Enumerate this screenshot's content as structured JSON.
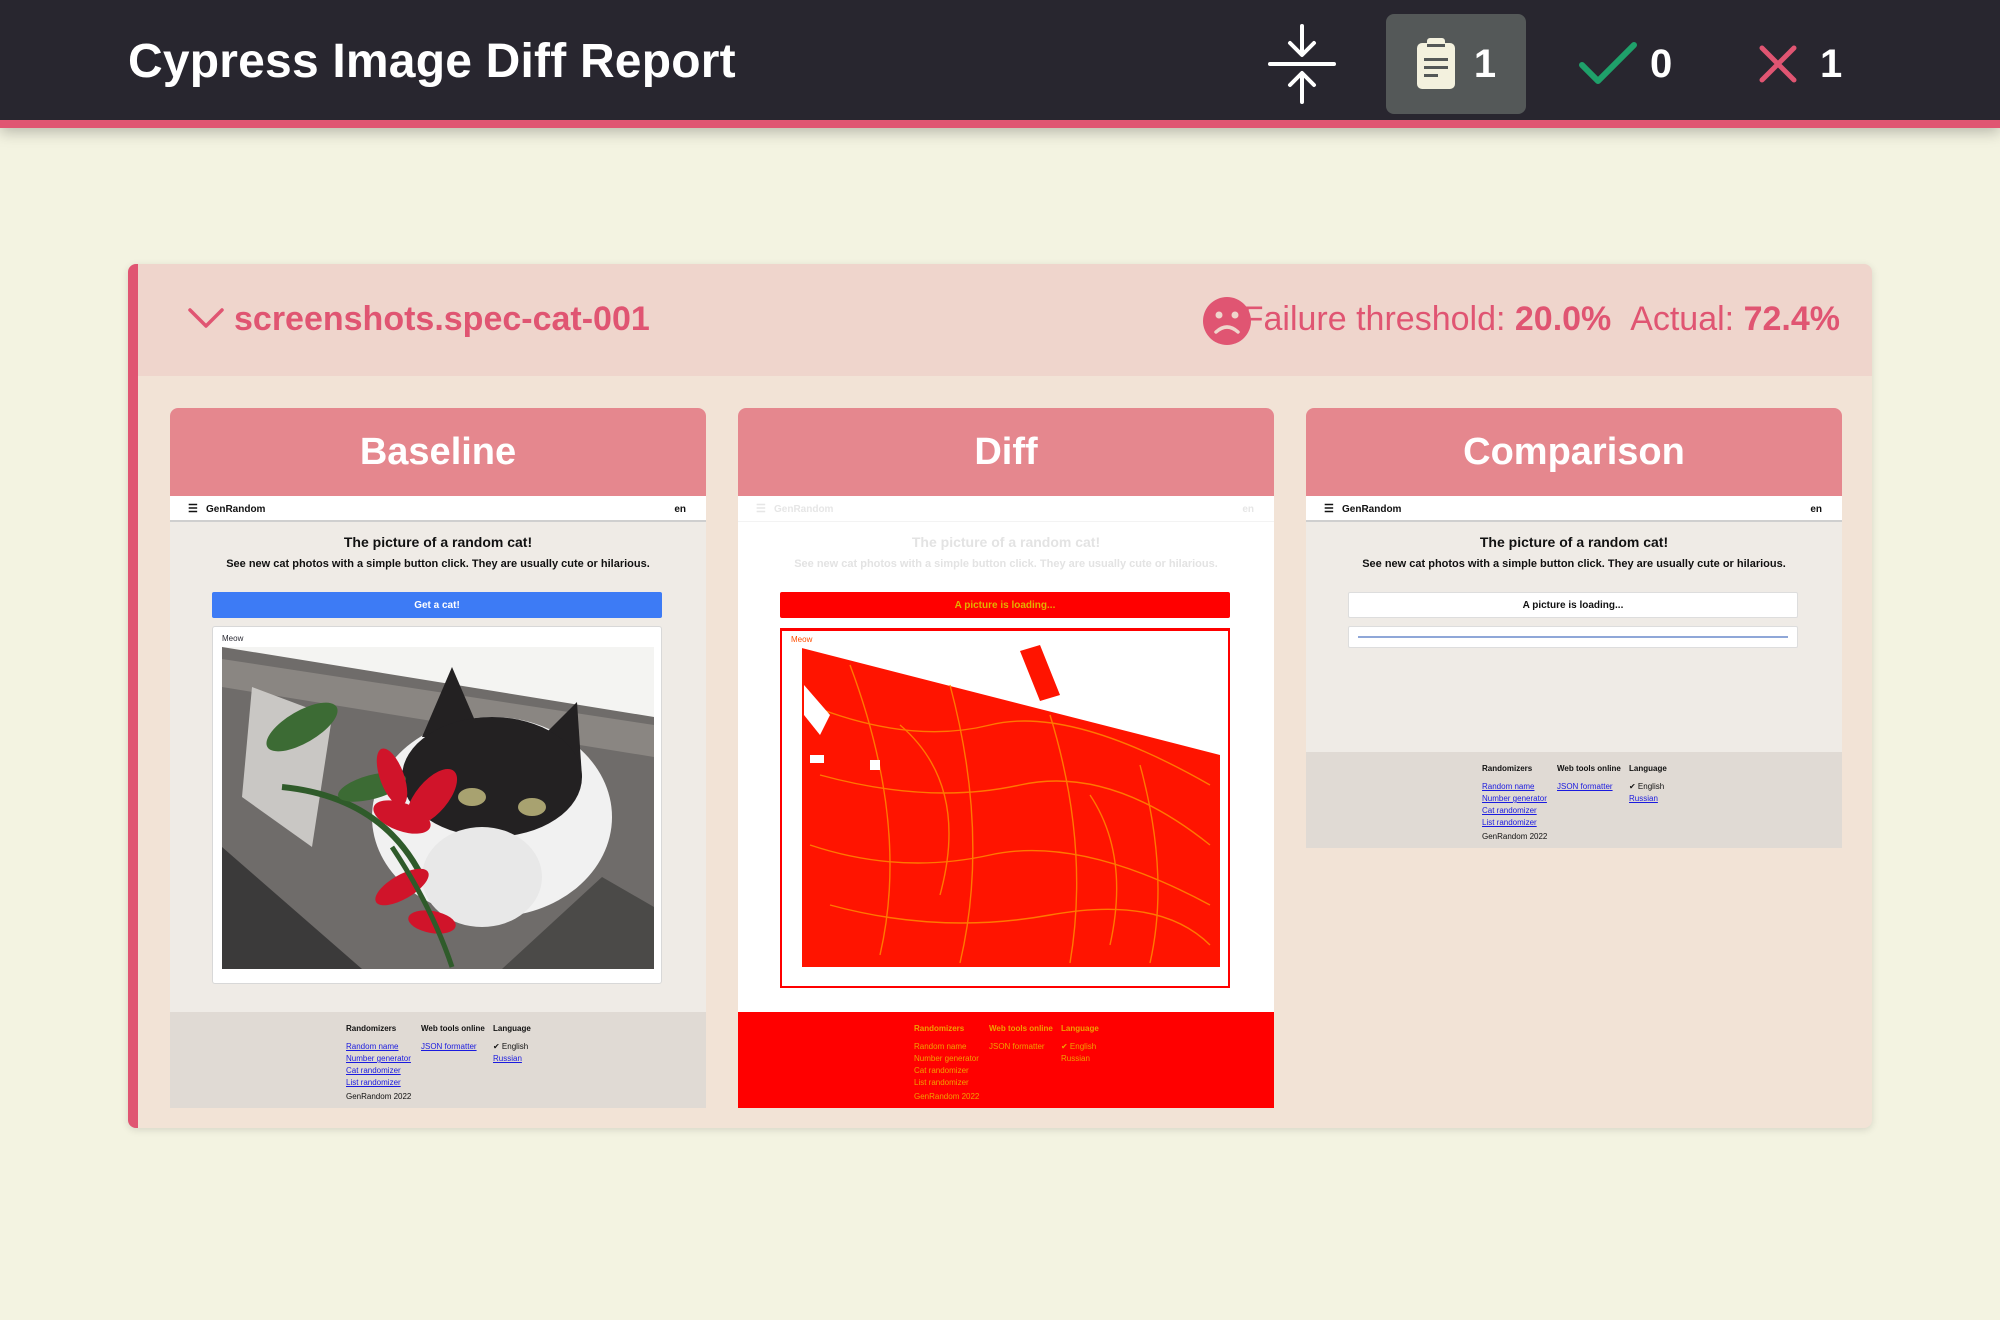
{
  "app": {
    "title": "Cypress Image Diff Report",
    "counts": {
      "total": "1",
      "passed": "0",
      "failed": "1"
    }
  },
  "colors": {
    "topbar": "#28262f",
    "accent": "#e05572",
    "pass": "#1fa06a",
    "panel_header": "#e5878e",
    "diff_red": "#ff0000"
  },
  "icons": {
    "collapse": "collapse-all-icon",
    "total": "clipboard-icon",
    "passed": "checkmark-icon",
    "failed": "cross-icon",
    "status": "sad-face-icon",
    "toggle": "chevron-down-icon"
  },
  "test": {
    "name": "screenshots.spec-cat-001",
    "threshold_label": "Failure threshold:",
    "threshold_value": "20.0%",
    "actual_label": "Actual:",
    "actual_value": "72.4%"
  },
  "panels": {
    "baseline": "Baseline",
    "diff": "Diff",
    "comparison": "Comparison"
  },
  "shot": {
    "brand": "GenRandom",
    "lang": "en",
    "title": "The picture of a random cat!",
    "subtitle": "See new cat photos with a simple button click. They are usually cute or hilarious.",
    "baseline_button": "Get a cat!",
    "comparison_button": "A picture is loading...",
    "diff_button": "A picture is loading...",
    "meow": "Meow",
    "footer": {
      "col1_title": "Randomizers",
      "col1_links": [
        "Random name",
        "Number generator",
        "Cat randomizer",
        "List randomizer"
      ],
      "col2_title": "Web tools online",
      "col2_links": [
        "JSON formatter"
      ],
      "col3_title": "Language",
      "col3_current": "✔ English",
      "col3_links": [
        "Russian"
      ],
      "copyright": "GenRandom 2022"
    }
  }
}
